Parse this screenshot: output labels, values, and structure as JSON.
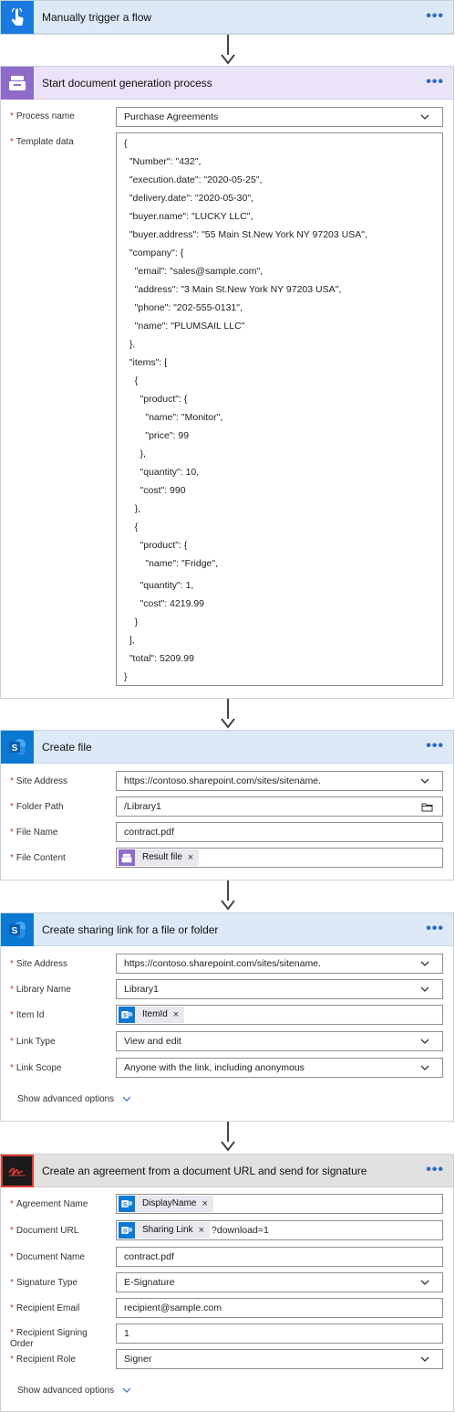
{
  "trigger": {
    "title": "Manually trigger a flow",
    "more": "•••"
  },
  "docgen": {
    "title": "Start document generation process",
    "more": "•••",
    "process_name": {
      "label": "Process name",
      "value": "Purchase Agreements"
    },
    "template_data": {
      "label": "Template data",
      "lines": [
        "{",
        "  \"Number\": \"432\",",
        "  \"execution.date\": \"2020-05-25\",",
        "  \"delivery.date\": \"2020-05-30\",",
        "  \"buyer.name\": \"LUCKY LLC\",",
        "  \"buyer.address\": \"55 Main St.New York NY 97203 USA\",",
        "  \"company\": {",
        "    \"email\": \"sales@sample.com\",",
        "    \"address\": \"3 Main St.New York NY 97203 USA\",",
        "    \"phone\": \"202-555-0131\",",
        "    \"name\": \"PLUMSAIL LLC\"",
        "  },",
        "  \"items\": [",
        "    {",
        "      \"product\": {",
        "        \"name\": \"Monitor\",",
        "        \"price\": 99",
        "      },",
        "      \"quantity\": 10,",
        "      \"cost\": 990",
        "    },",
        "    {",
        "      \"product\": {",
        "        \"name\": \"Fridge\",",
        "      \"quantity\": 1,",
        "      \"cost\": 4219.99",
        "    }",
        "  ],",
        "  \"total\": 5209.99",
        "}"
      ]
    }
  },
  "create_file": {
    "title": "Create file",
    "more": "•••",
    "site_address": {
      "label": "Site Address",
      "value": "https://contoso.sharepoint.com/sites/sitename."
    },
    "folder_path": {
      "label": "Folder Path",
      "value": "/Library1"
    },
    "file_name": {
      "label": "File Name",
      "value": "contract.pdf"
    },
    "file_content": {
      "label": "File Content",
      "token": "Result file",
      "remove": "×"
    }
  },
  "sharing": {
    "title": "Create sharing link for a file or folder",
    "more": "•••",
    "site_address": {
      "label": "Site Address",
      "value": "https://contoso.sharepoint.com/sites/sitename."
    },
    "library_name": {
      "label": "Library Name",
      "value": "Library1"
    },
    "item_id": {
      "label": "Item Id",
      "token": "ItemId",
      "remove": "×"
    },
    "link_type": {
      "label": "Link Type",
      "value": "View and edit"
    },
    "link_scope": {
      "label": "Link Scope",
      "value": "Anyone with the link, including anonymous"
    },
    "advanced": "Show advanced options"
  },
  "agreement": {
    "title": "Create an agreement from a document URL and send for signature",
    "more": "•••",
    "agreement_name": {
      "label": "Agreement Name",
      "token": "DisplayName",
      "remove": "×"
    },
    "document_url": {
      "label": "Document URL",
      "token": "Sharing Link",
      "remove": "×",
      "suffix": "?download=1"
    },
    "document_name": {
      "label": "Document Name",
      "value": "contract.pdf"
    },
    "signature_type": {
      "label": "Signature Type",
      "value": "E-Signature"
    },
    "recipient_email": {
      "label": "Recipient Email",
      "value": "recipient@sample.com"
    },
    "recipient_signing_order": {
      "label1": "Recipient Signing",
      "label2": "Order",
      "value": "1"
    },
    "recipient_role": {
      "label": "Recipient Role",
      "value": "Signer"
    },
    "advanced": "Show advanced options"
  },
  "colors": {
    "trigger_header": "#dde9f6",
    "docgen_header": "#ebe3f7",
    "sp_icon": "#0b78d4",
    "adobe_header": "#e1e1e1",
    "required": "#c0392b"
  },
  "icons": [
    "hand-pointer-icon",
    "document-tray-icon",
    "sharepoint-icon",
    "adobe-sign-icon",
    "chevron-down-icon",
    "folder-icon"
  ]
}
